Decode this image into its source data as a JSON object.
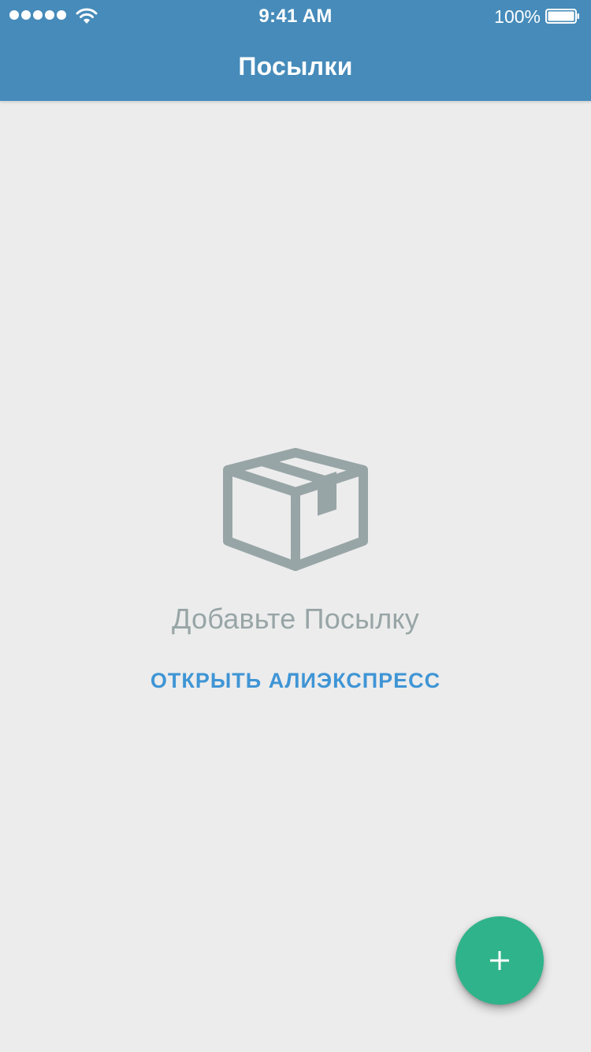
{
  "status_bar": {
    "time": "9:41 AM",
    "battery_percent": "100%",
    "signal_bars": 5,
    "battery_level": 1.0
  },
  "header": {
    "title": "Посылки",
    "background_color": "#468bba"
  },
  "empty_state": {
    "icon": "package-box-icon",
    "message": "Добавьте Посылку",
    "link_label": "ОТКРЫТЬ АЛИЭКСПРЕСС"
  },
  "fab": {
    "icon": "plus-icon",
    "color": "#2fb38a"
  }
}
